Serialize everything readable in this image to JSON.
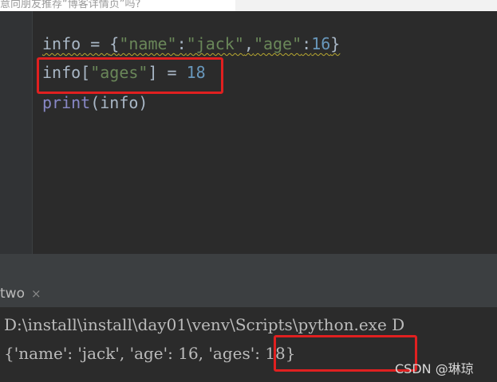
{
  "top_caption": "意向朋友推荐“博客详情页”吗?",
  "editor": {
    "line1": {
      "var": "info",
      "op": " = ",
      "open": "{",
      "k1": "\"name\"",
      "colon1": ":",
      "v1": "\"jack\"",
      "comma": ",",
      "k2": "\"age\"",
      "colon2": ":",
      "v2": "16",
      "close": "}"
    },
    "line2": {
      "var": "info",
      "open": "[",
      "key": "\"ages\"",
      "close": "]",
      "op": " = ",
      "val": "18"
    },
    "line3": {
      "func": "print",
      "args": "(info)"
    }
  },
  "run_panel": {
    "tab_label": "two",
    "close_glyph": "×"
  },
  "console": {
    "command": "D:\\install\\install\\day01\\venv\\Scripts\\python.exe D",
    "output_prefix": "{'name': 'jack', 'age': 16, ",
    "output_highlight": "'ages': 18}"
  },
  "watermark": "CSDN @琳琼"
}
